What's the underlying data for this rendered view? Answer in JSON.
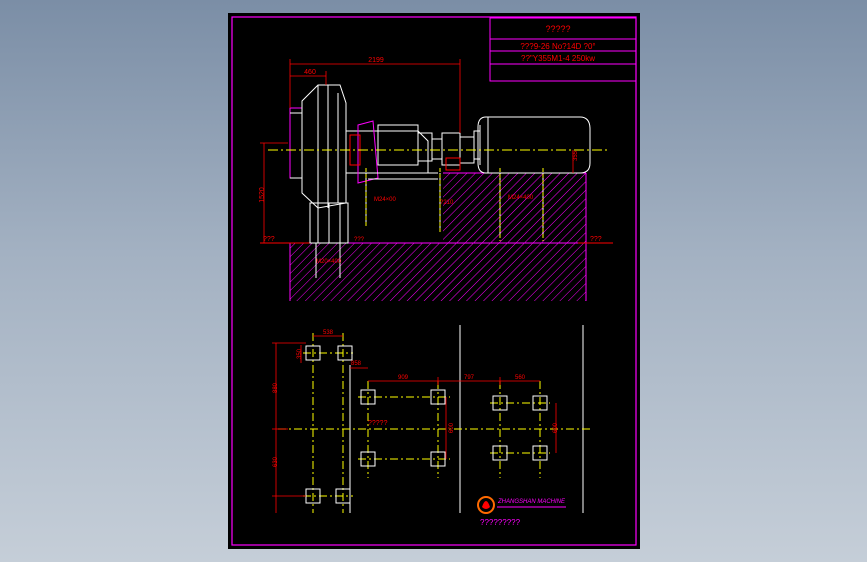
{
  "title_block": {
    "title": "?????",
    "spec_line1": "???9-26 No?14D ?0°",
    "spec_line2": "??\"Y355M1-4 250kw"
  },
  "elevation_view": {
    "dim_top_long": "2199",
    "dim_top_short": "460",
    "dim_height": "1520",
    "dim_motor": "355",
    "ground_left": "???",
    "ground_right": "???",
    "bolt_left": "M20×400",
    "bolt_mid1": "M24×00",
    "bolt_mid2": "?210",
    "bolt_right": "M24×400",
    "base_mark": "???"
  },
  "plan_view": {
    "dim_538": "538",
    "dim_350": "350",
    "dim_858": "858",
    "dim_880": "880",
    "dim_630": "630",
    "dim_909": "909",
    "dim_797": "797",
    "dim_560": "560",
    "dim_600": "600",
    "dim_600b": "600",
    "center_label": "?????"
  },
  "logo": {
    "company_line": "ZHANGSHAN MACHINE",
    "subtitle": "?????????"
  },
  "colors": {
    "frame": "#ff00ff",
    "text": "#ff0000",
    "geometry": "#ffffff",
    "center": "#ffff00"
  }
}
